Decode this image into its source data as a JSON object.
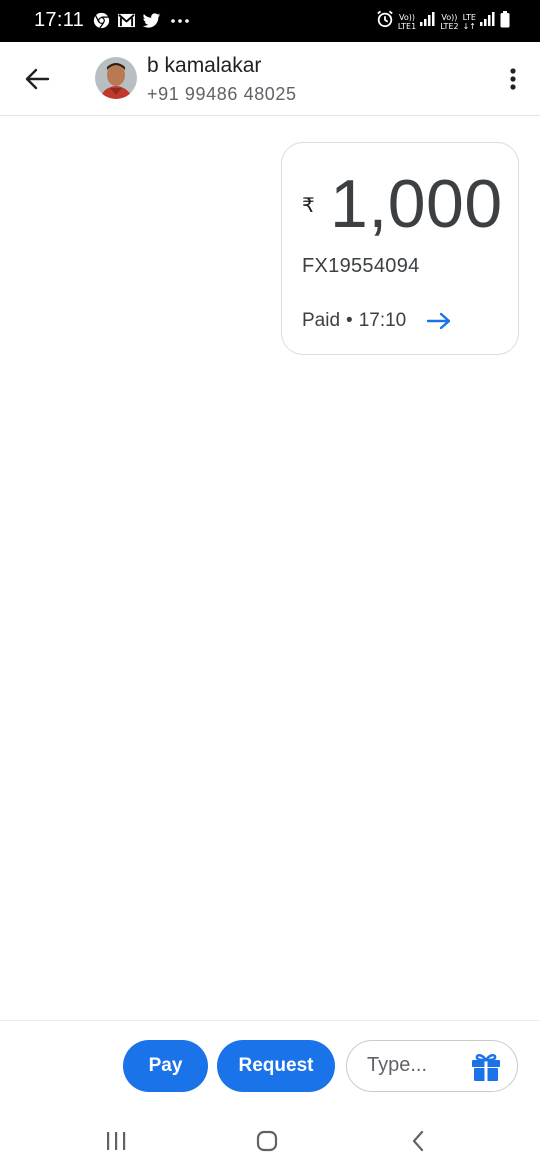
{
  "status_bar": {
    "time": "17:11",
    "notification_icons": [
      "chrome-icon",
      "gmail-icon",
      "twitter-icon",
      "more-dots-icon"
    ],
    "sim1_label_top": "Vo))",
    "sim1_label_bottom": "LTE1",
    "sim2_label_top": "Vo))",
    "sim2_label_bottom": "LTE2",
    "data_label": "LTE"
  },
  "header": {
    "contact_name": "b kamalakar",
    "contact_phone": "+91 99486 48025"
  },
  "payment": {
    "currency_symbol": "₹",
    "amount": "1,000",
    "transaction_id": "FX19554094",
    "status": "Paid",
    "separator": "•",
    "time": "17:10"
  },
  "actions": {
    "pay_label": "Pay",
    "request_label": "Request",
    "message_placeholder": "Type..."
  },
  "colors": {
    "accent": "#1a73e8",
    "text_primary": "#202124",
    "text_secondary": "#5f6368",
    "card_border": "#dadce0"
  }
}
